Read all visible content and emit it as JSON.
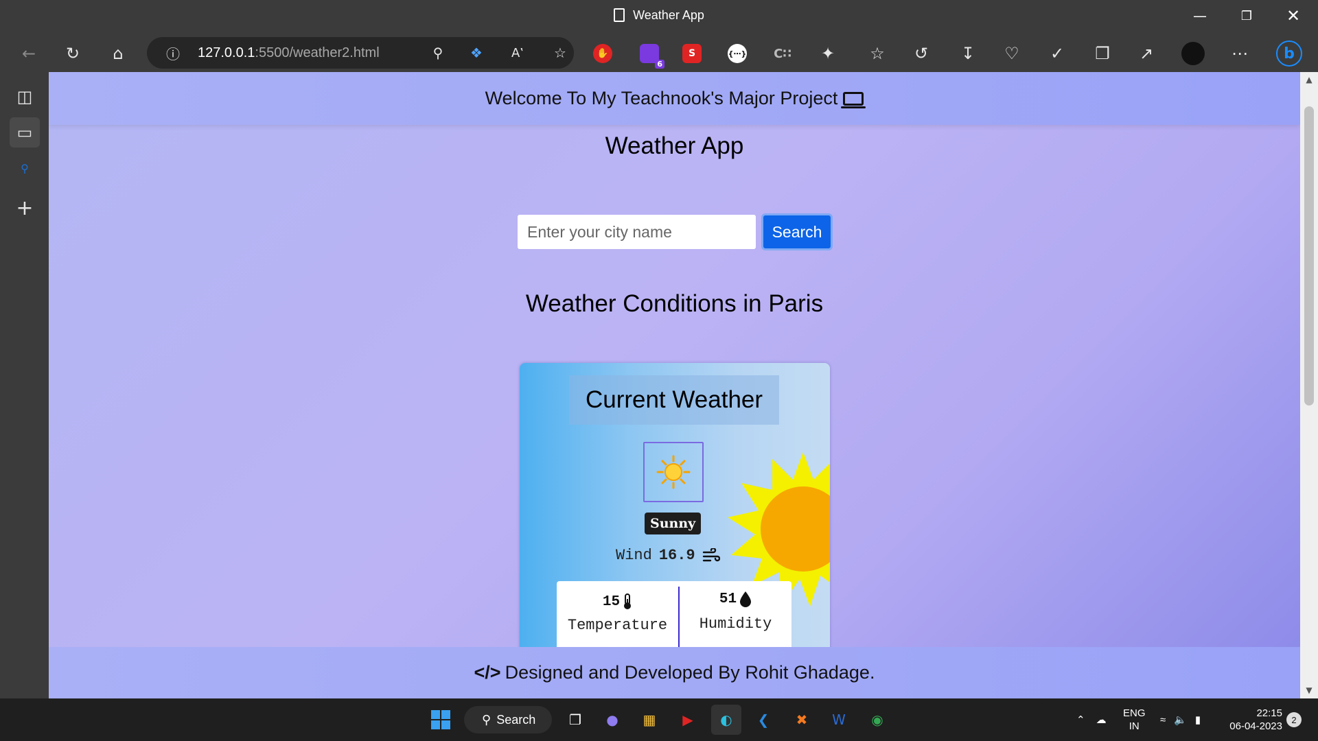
{
  "window": {
    "title": "Weather App"
  },
  "browser": {
    "url_host": "127.0.0.1",
    "url_rest": ":5500/weather2.html",
    "extension_badge": "6"
  },
  "page": {
    "header_text": "Welcome To My Teachnook's Major Project",
    "app_title": "Weather App",
    "search": {
      "placeholder": "Enter your city name",
      "value": "",
      "button_label": "Search"
    },
    "conditions_title": "Weather Conditions in Paris",
    "card": {
      "title": "Current Weather",
      "condition": "Sunny",
      "wind_label": "Wind",
      "wind_value": "16.9",
      "temperature_value": "15",
      "temperature_label": "Temperature",
      "humidity_value": "51",
      "humidity_label": "Humidity"
    },
    "footer_text": "Designed and Developed By Rohit Ghadage."
  },
  "taskbar": {
    "search_label": "Search",
    "language": "ENG",
    "region": "IN",
    "time": "22:15",
    "date": "06-04-2023",
    "notification_count": "2"
  },
  "colors": {
    "page_gradient_start": "#b3b6f4",
    "page_gradient_end": "#8a89e8",
    "search_button": "#0d64e8",
    "card_blue": "#4eb0f0",
    "sun_yellow": "#f4f000",
    "sun_orange": "#f7a800"
  },
  "icons": [
    "back-icon",
    "refresh-icon",
    "home-icon",
    "info-icon",
    "location-icon",
    "tag-icon",
    "read-aloud-icon",
    "add-favorite-icon",
    "favorites-icon",
    "history-icon",
    "download-icon",
    "health-icon",
    "extensions-icon",
    "collections-icon",
    "share-icon",
    "profile-icon",
    "more-icon",
    "bing-icon",
    "laptop-icon",
    "sun-icon",
    "wind-icon",
    "thermometer-icon",
    "droplet-icon",
    "code-icon"
  ]
}
